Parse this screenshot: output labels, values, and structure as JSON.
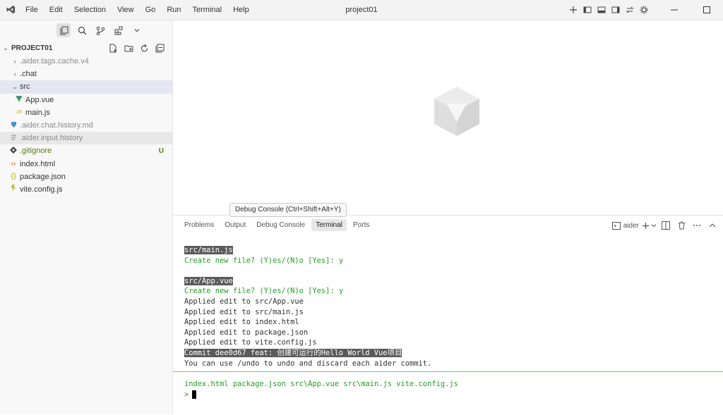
{
  "window": {
    "title": "project01"
  },
  "menu": [
    "File",
    "Edit",
    "Selection",
    "View",
    "Go",
    "Run",
    "Terminal",
    "Help"
  ],
  "explorer": {
    "header": "PROJECT01",
    "items": [
      {
        "label": ".aider.tags.cache.v4",
        "type": "folder",
        "dim": true
      },
      {
        "label": ".chat",
        "type": "folder",
        "dim": false
      },
      {
        "label": "src",
        "type": "folder-open",
        "dim": false,
        "selected": true
      },
      {
        "label": "App.vue",
        "type": "vue",
        "child": true
      },
      {
        "label": "main.js",
        "type": "js",
        "child": true
      },
      {
        "label": ".aider.chat.history.md",
        "type": "md",
        "dim": true
      },
      {
        "label": ".aider.input.history",
        "type": "text",
        "dim": true,
        "hovered": true
      },
      {
        "label": ".gitignore",
        "type": "git",
        "status": "U",
        "color": "#587c0c"
      },
      {
        "label": "index.html",
        "type": "html"
      },
      {
        "label": "package.json",
        "type": "json"
      },
      {
        "label": "vite.config.js",
        "type": "vite"
      }
    ]
  },
  "tooltip": "Debug Console (Ctrl+Shift+Alt+Y)",
  "panel": {
    "tabs": [
      "Problems",
      "Output",
      "Debug Console",
      "Terminal",
      "Ports"
    ],
    "active_tab": "Terminal",
    "terminal_name": "aider",
    "lines": [
      {
        "text": "src/main.js",
        "style": "hl"
      },
      {
        "text": "Create new file? (Y)es/(N)o [Yes]: y",
        "style": "green"
      },
      {
        "text": "",
        "style": "dark"
      },
      {
        "text": "src/App.vue",
        "style": "hl"
      },
      {
        "text": "Create new file? (Y)es/(N)o [Yes]: y",
        "style": "green"
      },
      {
        "text": "Applied edit to src/App.vue",
        "style": "dark"
      },
      {
        "text": "Applied edit to src/main.js",
        "style": "dark"
      },
      {
        "text": "Applied edit to index.html",
        "style": "dark"
      },
      {
        "text": "Applied edit to package.json",
        "style": "dark"
      },
      {
        "text": "Applied edit to vite.config.js",
        "style": "dark"
      },
      {
        "text": "Commit dee0d67 feat: 创建可运行的Hello World Vue项目",
        "style": "hl"
      },
      {
        "text": "You can use /undo to undo and discard each aider commit.",
        "style": "dark"
      }
    ],
    "files_line": "index.html package.json src\\App.vue src\\main.js vite.config.js",
    "prompt": ">"
  },
  "colors": {
    "accent": "#23a023",
    "untracked": "#587c0c",
    "highlight_bg": "#5a5a5a"
  }
}
